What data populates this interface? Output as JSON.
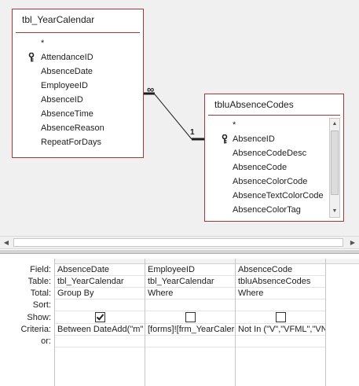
{
  "tables": [
    {
      "name": "tbl_YearCalendar",
      "fields": [
        {
          "name": "*",
          "key": false
        },
        {
          "name": "AttendanceID",
          "key": true
        },
        {
          "name": "AbsenceDate",
          "key": false
        },
        {
          "name": "EmployeeID",
          "key": false
        },
        {
          "name": "AbsenceID",
          "key": false
        },
        {
          "name": "AbsenceTime",
          "key": false
        },
        {
          "name": "AbsenceReason",
          "key": false
        },
        {
          "name": "RepeatForDays",
          "key": false
        }
      ]
    },
    {
      "name": "tbluAbsenceCodes",
      "fields": [
        {
          "name": "*",
          "key": false
        },
        {
          "name": "AbsenceID",
          "key": true
        },
        {
          "name": "AbsenceCodeDesc",
          "key": false
        },
        {
          "name": "AbsenceCode",
          "key": false
        },
        {
          "name": "AbsenceColorCode",
          "key": false
        },
        {
          "name": "AbsenceTextColorCode",
          "key": false
        },
        {
          "name": "AbsenceColorTag",
          "key": false
        }
      ]
    }
  ],
  "relationship": {
    "many_label": "∞",
    "one_label": "1"
  },
  "grid": {
    "row_labels": {
      "field": "Field:",
      "table": "Table:",
      "total": "Total:",
      "sort": "Sort:",
      "show": "Show:",
      "criteria": "Criteria:",
      "or": "or:"
    },
    "columns": [
      {
        "field": "AbsenceDate",
        "table": "tbl_YearCalendar",
        "total": "Group By",
        "sort": "",
        "show": true,
        "criteria": "Between DateAdd(\"m\"",
        "or": ""
      },
      {
        "field": "EmployeeID",
        "table": "tbl_YearCalendar",
        "total": "Where",
        "sort": "",
        "show": false,
        "criteria": "[forms]![frm_YearCaler",
        "or": ""
      },
      {
        "field": "AbsenceCode",
        "table": "tbluAbsenceCodes",
        "total": "Where",
        "sort": "",
        "show": false,
        "criteria": "Not In (\"V\",\"VFML\",\"VN",
        "or": ""
      }
    ]
  },
  "colors": {
    "table_border": "#a4373a",
    "pane_background": "#f0f0f0"
  }
}
